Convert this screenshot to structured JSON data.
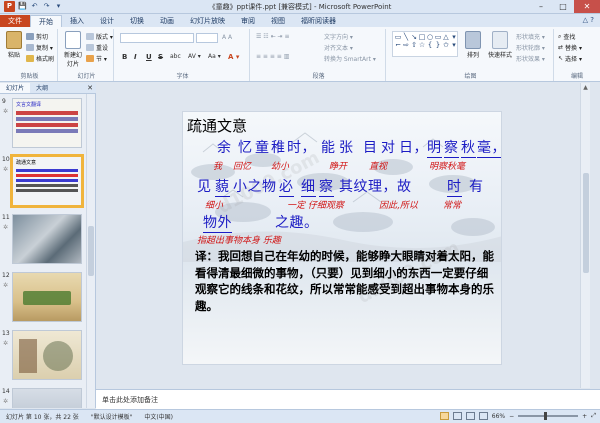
{
  "window": {
    "title": "《童趣》ppt课件.ppt [兼容模式] - Microsoft PowerPoint",
    "controls": [
      "–",
      "□",
      "✕"
    ]
  },
  "qat": {
    "logo": "P",
    "buttons": [
      "💾",
      "↶",
      "↷",
      "▾"
    ]
  },
  "tabs": [
    {
      "label": "文件"
    },
    {
      "label": "开始"
    },
    {
      "label": "插入"
    },
    {
      "label": "设计"
    },
    {
      "label": "切换"
    },
    {
      "label": "动画"
    },
    {
      "label": "幻灯片放映"
    },
    {
      "label": "审阅"
    },
    {
      "label": "视图"
    },
    {
      "label": "福昕阅读器"
    }
  ],
  "help_icon": "△ ?",
  "ribbon": {
    "clipboard": {
      "label": "剪贴板",
      "paste": "粘贴",
      "cut": "剪切",
      "copy": "复制 ▾",
      "format_painter": "格式刷"
    },
    "slides": {
      "label": "幻灯片",
      "new_slide": "新建幻灯片",
      "layout": "版式 ▾",
      "reset": "重设",
      "section": "节 ▾"
    },
    "font": {
      "label": "字体",
      "font_name": "",
      "font_size": "",
      "bold": "B",
      "italic": "I",
      "underline": "U",
      "strike": "S",
      "shadow": "abc",
      "spacing": "AV ▾",
      "case": "Aa ▾",
      "color": "A ▾"
    },
    "paragraph": {
      "label": "段落",
      "text_direction": "文字方向 ▾",
      "align_text": "对齐文本 ▾",
      "smartart": "转换为 SmartArt ▾"
    },
    "drawing": {
      "label": "绘图",
      "arrange": "排列",
      "quick_styles": "快速样式",
      "shape_fill": "形状填充 ▾",
      "shape_outline": "形状轮廓 ▾",
      "shape_effects": "形状效果 ▾"
    },
    "editing": {
      "label": "编辑",
      "find": "查找",
      "replace": "替换 ▾",
      "select": "选择 ▾"
    }
  },
  "pane": {
    "tabs": [
      {
        "label": "幻灯片"
      },
      {
        "label": "大纲"
      }
    ],
    "close": "✕",
    "thumbnails": [
      {
        "num": "9",
        "star": "✲",
        "caption": "文言文翻译"
      },
      {
        "num": "10",
        "star": "✲",
        "caption": "疏通文意"
      },
      {
        "num": "11",
        "star": "✲",
        "caption": ""
      },
      {
        "num": "12",
        "star": "✲",
        "caption": ""
      },
      {
        "num": "13",
        "star": "✲",
        "caption": ""
      },
      {
        "num": "14",
        "star": "✲",
        "caption": ""
      }
    ]
  },
  "slide": {
    "title": "疏通文意",
    "line1": [
      "余",
      "忆",
      "童",
      "稚",
      "时，",
      "能",
      "张",
      "目",
      "对",
      "日，",
      "明",
      "察",
      "秋",
      "毫，"
    ],
    "note1": [
      "我",
      "回忆",
      "幼小",
      "睁开",
      "直视",
      "明察秋毫"
    ],
    "line2": [
      "见",
      "藐",
      "小之物",
      "必",
      "细",
      "察",
      "其纹理，故",
      "时",
      "有"
    ],
    "note2": [
      "细小",
      "一定 仔细观察",
      "因此,所以",
      "常常"
    ],
    "line3": [
      "物外",
      "之趣。"
    ],
    "note3": "指超出事物本身   乐趣",
    "translation": "译：我回想自己在年幼的时候，能够睁大眼睛对着太阳，能看得清最细微的事物，（只要）见到细小的东西一定要仔细观察它的线条和花纹，所以常常能感受到超出事物本身的乐趣。",
    "watermark": "d1000.com"
  },
  "notes": {
    "placeholder": "单击此处添加备注"
  },
  "status": {
    "slide_info": "幻灯片 第 10 张，共 22 张",
    "theme": "\"默认设计模板\"",
    "language": "中文(中国)",
    "zoom": "66%",
    "zoom_minus": "−",
    "zoom_plus": "+",
    "fit": "⤢"
  },
  "colors": {
    "accent_file": "#c8461f",
    "slide_text_blue": "#1c1cc4",
    "slide_note_red": "#d11414",
    "selected_thumb": "#f0b43c"
  }
}
